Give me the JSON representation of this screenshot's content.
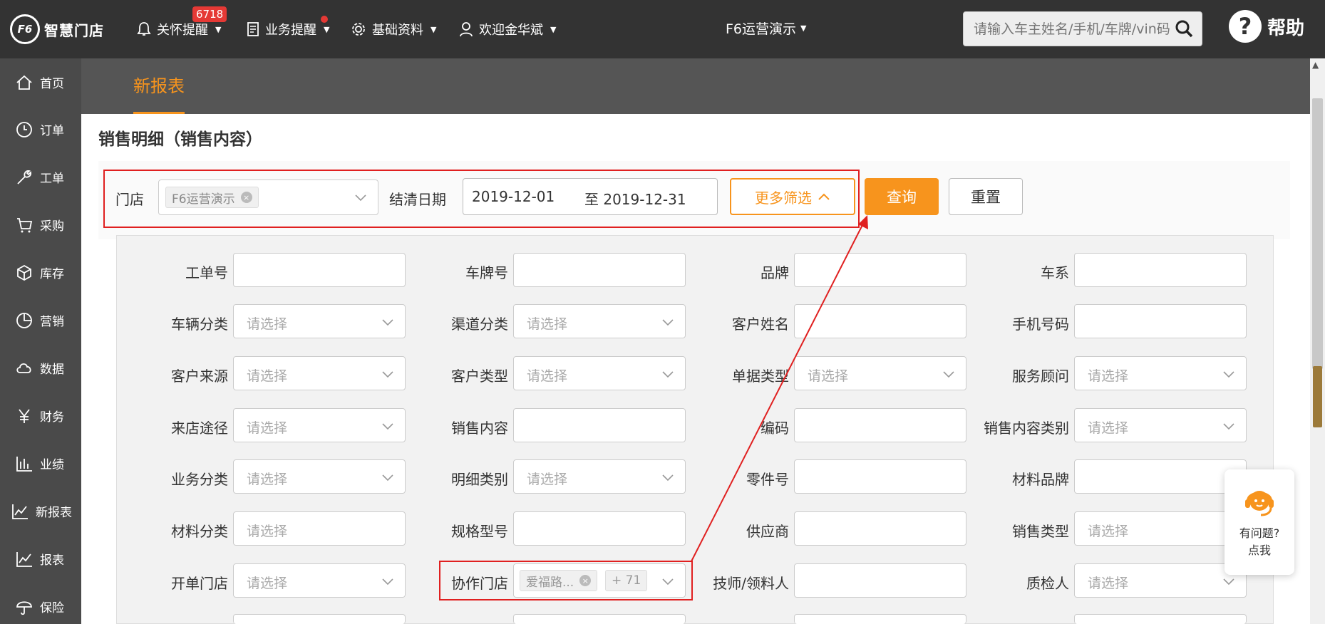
{
  "header": {
    "logo_mark": "F6",
    "logo_text": "智慧门店",
    "nav": [
      {
        "label": "关怀提醒",
        "badge": "6718"
      },
      {
        "label": "业务提醒"
      },
      {
        "label": "基础资料"
      },
      {
        "label": "欢迎金华斌"
      }
    ],
    "store": "F6运营演示",
    "search_placeholder": "请输入车主姓名/手机/车牌/vin码",
    "help": "帮助"
  },
  "sidebar": {
    "items": [
      {
        "label": "首页",
        "icon": "home-icon"
      },
      {
        "label": "订单",
        "icon": "clock-icon"
      },
      {
        "label": "工单",
        "icon": "wrench-icon"
      },
      {
        "label": "采购",
        "icon": "cart-icon"
      },
      {
        "label": "库存",
        "icon": "box-icon"
      },
      {
        "label": "营销",
        "icon": "pie-icon"
      },
      {
        "label": "数据",
        "icon": "cloud-icon"
      },
      {
        "label": "财务",
        "icon": "yen-icon"
      },
      {
        "label": "业绩",
        "icon": "bar-chart-icon"
      },
      {
        "label": "新报表",
        "icon": "line-chart-icon"
      },
      {
        "label": "报表",
        "icon": "line-chart-icon"
      },
      {
        "label": "保险",
        "icon": "umbrella-icon"
      }
    ]
  },
  "subheader": {
    "tab": "新报表"
  },
  "main": {
    "title": "销售明细（销售内容）",
    "filter": {
      "store_label": "门店",
      "store_tag": "F6运营演示",
      "date_label": "结清日期",
      "date_from": "2019-12-01",
      "date_to": "至 2019-12-31",
      "more_label": "更多筛选",
      "query_label": "查询",
      "reset_label": "重置"
    },
    "placeholder": "请选择",
    "fields": [
      {
        "label": "工单号",
        "type": "input"
      },
      {
        "label": "车牌号",
        "type": "input"
      },
      {
        "label": "品牌",
        "type": "input"
      },
      {
        "label": "车系",
        "type": "input"
      },
      {
        "label": "车辆分类",
        "type": "select"
      },
      {
        "label": "渠道分类",
        "type": "select"
      },
      {
        "label": "客户姓名",
        "type": "input"
      },
      {
        "label": "手机号码",
        "type": "input"
      },
      {
        "label": "客户来源",
        "type": "select"
      },
      {
        "label": "客户类型",
        "type": "select"
      },
      {
        "label": "单据类型",
        "type": "select"
      },
      {
        "label": "服务顾问",
        "type": "select"
      },
      {
        "label": "来店途径",
        "type": "select"
      },
      {
        "label": "销售内容",
        "type": "input"
      },
      {
        "label": "编码",
        "type": "input"
      },
      {
        "label": "销售内容类别",
        "type": "select"
      },
      {
        "label": "业务分类",
        "type": "select"
      },
      {
        "label": "明细类别",
        "type": "select"
      },
      {
        "label": "零件号",
        "type": "input"
      },
      {
        "label": "材料品牌",
        "type": "input"
      },
      {
        "label": "材料分类",
        "type": "select"
      },
      {
        "label": "规格型号",
        "type": "input"
      },
      {
        "label": "供应商",
        "type": "input"
      },
      {
        "label": "销售类型",
        "type": "select"
      },
      {
        "label": "开单门店",
        "type": "select"
      },
      {
        "label": "协作门店",
        "type": "tags",
        "tag": "爱福路...",
        "more": "+ 71"
      },
      {
        "label": "技师/领料人",
        "type": "input"
      },
      {
        "label": "质检人",
        "type": "select"
      }
    ]
  },
  "cs_float": {
    "line1": "有问题?",
    "line2": "点我"
  },
  "colors": {
    "accent": "#f7941d",
    "topbar": "#333333",
    "sidebar": "#4a4a4a",
    "annotation": "#e02020"
  }
}
